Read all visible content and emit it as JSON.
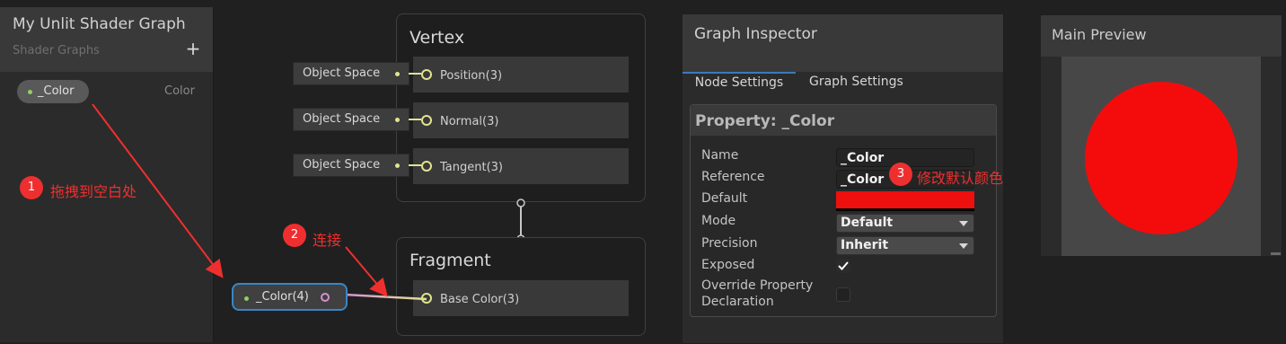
{
  "blackboard": {
    "title": "My Unlit Shader Graph",
    "subtitle": "Shader Graphs",
    "add_icon": "plus-icon",
    "property": {
      "name": "_Color",
      "type": "Color"
    }
  },
  "vertex": {
    "title": "Vertex",
    "ports": [
      {
        "label": "Position(3)",
        "input": "Object Space"
      },
      {
        "label": "Normal(3)",
        "input": "Object Space"
      },
      {
        "label": "Tangent(3)",
        "input": "Object Space"
      }
    ]
  },
  "fragment": {
    "title": "Fragment",
    "ports": [
      {
        "label": "Base Color(3)"
      }
    ]
  },
  "property_node": {
    "label": "_Color(4)"
  },
  "inspector": {
    "title": "Graph Inspector",
    "tabs": [
      "Node Settings",
      "Graph Settings"
    ],
    "property_title": "Property: _Color",
    "fields": {
      "name_label": "Name",
      "name_value": "_Color",
      "reference_label": "Reference",
      "reference_value": "_Color",
      "default_label": "Default",
      "default_color": "#ee0f0f",
      "mode_label": "Mode",
      "mode_value": "Default",
      "precision_label": "Precision",
      "precision_value": "Inherit",
      "exposed_label": "Exposed",
      "exposed_checked": true,
      "override_label_1": "Override Property",
      "override_label_2": "Declaration",
      "override_checked": false
    }
  },
  "preview": {
    "title": "Main Preview",
    "sphere_color": "#f40c0c"
  },
  "annotations": [
    {
      "number": "1",
      "text": "拖拽到空白处"
    },
    {
      "number": "2",
      "text": "连接"
    },
    {
      "number": "3",
      "text": "修改默认颜色"
    }
  ],
  "colors": {
    "annotation": "#ef2f2f",
    "port": "#e1e48e",
    "selection": "#3886c7"
  }
}
